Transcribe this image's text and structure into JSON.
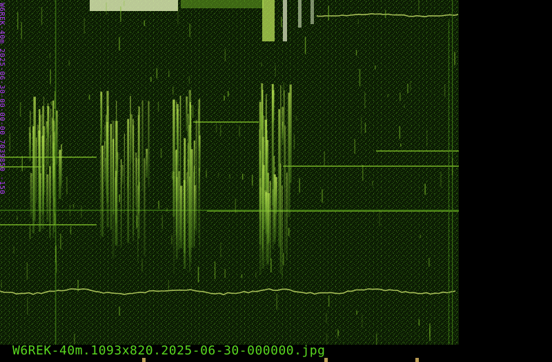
{
  "image": {
    "side_label": "W6REK-40m 2025-06-30-00-00-00 7039850 -150",
    "filename_caption": "W6REK-40m.1093x820.2025-06-30-000000.jpg"
  },
  "colors": {
    "background": "#000000",
    "waterfall_base": "#0b1a03",
    "signal_bright": "#c8f060",
    "signal_mid": "#7fbf2a",
    "signal_dim": "#3f7a14",
    "side_label": "#b43cff",
    "caption": "#59d81f",
    "tick_marks": "#b89a52"
  },
  "icons": {
    "tick_marker": "tick-marker"
  }
}
